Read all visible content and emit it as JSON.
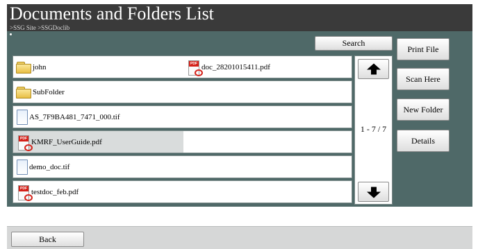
{
  "window": {
    "title": "Documents and Folders List",
    "breadcrumb": ">SSG Site >SSGDoclib"
  },
  "toolbar": {
    "search_label": "Search"
  },
  "file_list": {
    "rows": [
      {
        "left": {
          "name": "john",
          "icon": "folder-icon"
        },
        "right": {
          "name": "doc_28201015411.pdf",
          "icon": "pdf-icon"
        }
      },
      {
        "left": {
          "name": "SubFolder",
          "icon": "folder-icon"
        }
      },
      {
        "left": {
          "name": "AS_7F9BA481_7471_000.tif",
          "icon": "tif-file-icon"
        }
      },
      {
        "left": {
          "name": "KMRF_UserGuide.pdf",
          "icon": "pdf-icon"
        },
        "selected": true
      },
      {
        "left": {
          "name": "demo_doc.tif",
          "icon": "tif-file-icon"
        }
      },
      {
        "left": {
          "name": "testdoc_feb.pdf",
          "icon": "pdf-icon"
        }
      }
    ]
  },
  "pagination": {
    "page_indicator": "1 - 7 / 7",
    "up_icon": "arrow-up-icon",
    "down_icon": "arrow-down-icon"
  },
  "side_buttons": {
    "print_file": "Print File",
    "scan_here": "Scan Here",
    "new_folder": "New Folder",
    "details": "Details"
  },
  "footer": {
    "back_label": "Back"
  },
  "colors": {
    "title_bar": "#3a3a3a",
    "panel": "#4f6968",
    "selected_row": "#d9dcdc",
    "pdf_red": "#d4221a",
    "folder_yellow": "#f3d46a"
  }
}
